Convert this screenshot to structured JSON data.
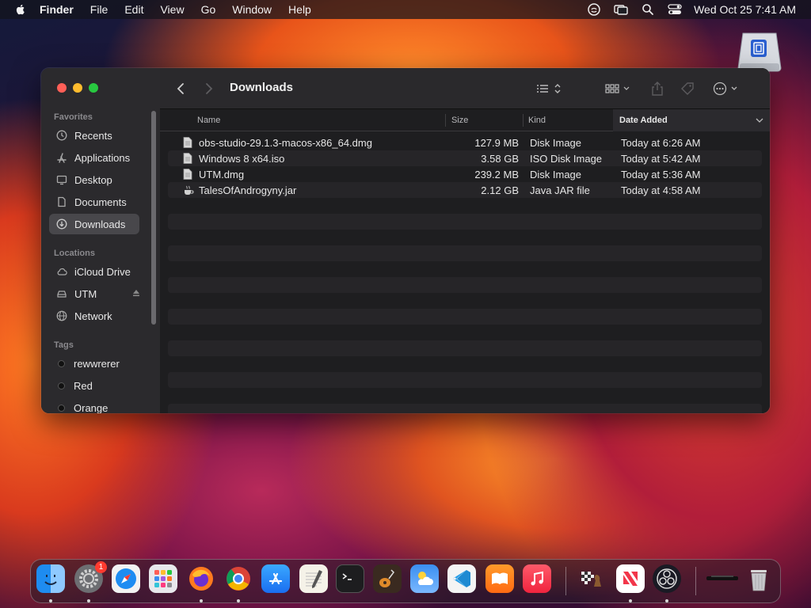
{
  "menubar": {
    "app_name": "Finder",
    "menus": [
      "File",
      "Edit",
      "View",
      "Go",
      "Window",
      "Help"
    ],
    "clock": "Wed Oct 25  7:41 AM",
    "status_icons": [
      "screen-share-icon",
      "display-mirroring-icon",
      "spotlight-search-icon",
      "control-center-icon"
    ]
  },
  "window": {
    "title": "Downloads",
    "sidebar": {
      "favorites_label": "Favorites",
      "favorites": [
        {
          "label": "Recents",
          "icon": "clock-icon"
        },
        {
          "label": "Applications",
          "icon": "applications-icon"
        },
        {
          "label": "Desktop",
          "icon": "desktop-icon"
        },
        {
          "label": "Documents",
          "icon": "document-icon"
        },
        {
          "label": "Downloads",
          "icon": "download-icon",
          "selected": true
        }
      ],
      "locations_label": "Locations",
      "locations": [
        {
          "label": "iCloud Drive",
          "icon": "cloud-icon"
        },
        {
          "label": "UTM",
          "icon": "drive-icon"
        },
        {
          "label": "Network",
          "icon": "globe-icon"
        }
      ],
      "tags_label": "Tags",
      "tags": [
        {
          "label": "rewwrerer"
        },
        {
          "label": "Red"
        },
        {
          "label": "Orange"
        }
      ]
    },
    "columns": {
      "name": "Name",
      "size": "Size",
      "kind": "Kind",
      "date_added": "Date Added"
    },
    "files": [
      {
        "name": "obs-studio-29.1.3-macos-x86_64.dmg",
        "size": "127.9 MB",
        "kind": "Disk Image",
        "date": "Today at 6:26 AM",
        "icon": "document-icon"
      },
      {
        "name": "Windows 8 x64.iso",
        "size": "3.58 GB",
        "kind": "ISO Disk Image",
        "date": "Today at 5:42 AM",
        "icon": "document-icon"
      },
      {
        "name": "UTM.dmg",
        "size": "239.2 MB",
        "kind": "Disk Image",
        "date": "Today at 5:36 AM",
        "icon": "document-icon"
      },
      {
        "name": "TalesOfAndrogyny.jar",
        "size": "2.12 GB",
        "kind": "Java JAR file",
        "date": "Today at 4:58 AM",
        "icon": "java-cup-icon"
      }
    ]
  },
  "dock": {
    "apps": [
      "Finder",
      "System Settings",
      "Safari",
      "Launchpad",
      "Firefox",
      "Chrome",
      "App Store",
      "TextEdit",
      "Terminal",
      "GarageBand",
      "Weather",
      "Visual Studio Code",
      "Books",
      "Music",
      "Chess",
      "News",
      "OBS",
      "Downloads Stack",
      "Trash"
    ],
    "settings_badge": "1"
  }
}
